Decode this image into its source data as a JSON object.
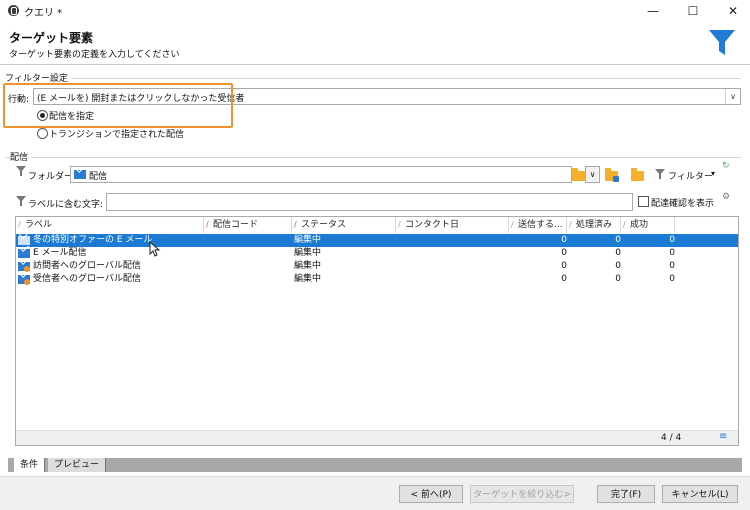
{
  "window": {
    "title": "クエリ *",
    "minimize": "—",
    "maximize": "☐",
    "close": "✕"
  },
  "header": {
    "title": "ターゲット要素",
    "subtitle": "ターゲット要素の定義を入力してください"
  },
  "filter_settings": {
    "group_label": "フィルター設定",
    "action_label": "行動:",
    "action_value": "(E メールを) 開封またはクリックしなかった受信者",
    "radio_options": [
      {
        "label": "配信を指定",
        "selected": true
      },
      {
        "label": "トランジションで指定された配信",
        "selected": false
      }
    ]
  },
  "delivery": {
    "group_label": "配信",
    "folder_label": "フォルダー:",
    "folder_value": "配信",
    "filter_button": "フィルター",
    "label_search_label": "ラベルに含む文字:",
    "label_search_value": "",
    "show_linked_label": "配達確認を表示"
  },
  "grid": {
    "columns": [
      "ラベル",
      "配信コード",
      "ステータス",
      "コンタクト日",
      "送信する...",
      "処理済み",
      "成功"
    ],
    "rows": [
      {
        "icon": "email-icon",
        "label": "冬の特別オファーの E メール",
        "code": "",
        "status": "編集中",
        "contact_date": "",
        "to_send": "0",
        "processed": "0",
        "success": "0",
        "selected": true
      },
      {
        "icon": "email-icon",
        "label": "E メール配信",
        "code": "",
        "status": "編集中",
        "contact_date": "",
        "to_send": "0",
        "processed": "0",
        "success": "0",
        "selected": false
      },
      {
        "icon": "email-orange-icon",
        "label": "訪問者へのグローバル配信",
        "code": "",
        "status": "編集中",
        "contact_date": "",
        "to_send": "0",
        "processed": "0",
        "success": "0",
        "selected": false
      },
      {
        "icon": "email-orange-icon",
        "label": "受信者へのグローバル配信",
        "code": "",
        "status": "編集中",
        "contact_date": "",
        "to_send": "0",
        "processed": "0",
        "success": "0",
        "selected": false
      }
    ],
    "page_count": "4 / 4"
  },
  "tabs": [
    {
      "label": "条件",
      "active": true
    },
    {
      "label": "プレビュー",
      "active": false
    }
  ],
  "buttons": {
    "back": "< 前へ(P)",
    "narrow": "ターゲットを絞り込む>",
    "finish": "完了(F)",
    "cancel": "キャンセル(L)"
  },
  "colors": {
    "accent": "#1a7ad4",
    "highlight_box": "#f0922b",
    "funnel": "#1f7bd6"
  }
}
